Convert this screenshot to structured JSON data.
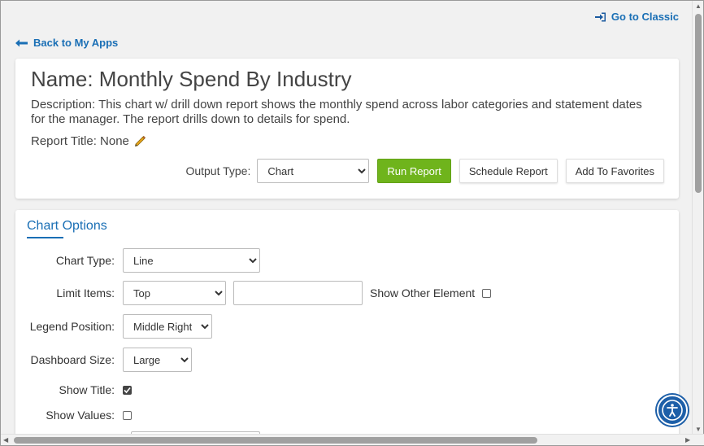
{
  "nav": {
    "classic_link": "Go to Classic",
    "back_link": "Back to My Apps"
  },
  "report": {
    "name": "Name: Monthly Spend By Industry",
    "description": "Description: This chart w/ drill down report shows the monthly spend across labor categories and statement dates for the manager. The report drills down to details for spend.",
    "title_label": "Report Title: None",
    "output_type_label": "Output Type:",
    "output_type_value": "Chart",
    "run_button": "Run Report",
    "schedule_button": "Schedule Report",
    "favorites_button": "Add To Favorites"
  },
  "chart_options": {
    "tab_title": "Chart Options",
    "chart_type_label": "Chart Type:",
    "chart_type_value": "Line",
    "limit_items_label": "Limit Items:",
    "limit_items_value": "Top",
    "limit_items_count": "",
    "show_other_label": "Show Other Element",
    "show_other_checked": false,
    "legend_position_label": "Legend Position:",
    "legend_position_value": "Middle Right",
    "dashboard_size_label": "Dashboard Size:",
    "dashboard_size_value": "Large",
    "show_title_label": "Show Title:",
    "show_title_checked": true,
    "show_values_label": "Show Values:",
    "show_values_checked": false
  },
  "colors": {
    "link": "#1a6fb5",
    "primary_button": "#6fb41c",
    "accessibility_button": "#1d5fa8"
  },
  "icons": {
    "classic": "sign-in-icon",
    "back": "arrow-left-icon",
    "edit": "pencil-icon",
    "accessibility": "accessibility-icon"
  }
}
